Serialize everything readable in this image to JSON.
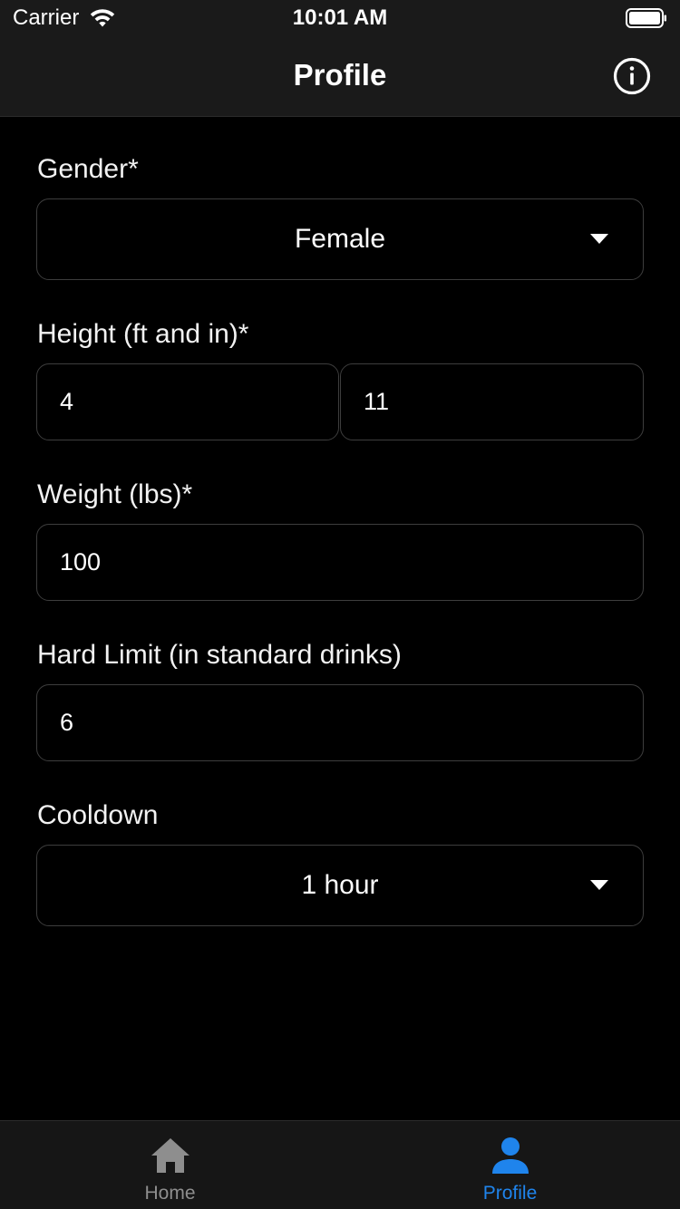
{
  "status_bar": {
    "carrier": "Carrier",
    "time": "10:01 AM",
    "wifi_icon": "wifi-icon",
    "battery_icon": "battery-icon"
  },
  "nav": {
    "title": "Profile",
    "info_icon": "info-icon"
  },
  "form": {
    "gender": {
      "label": "Gender*",
      "value": "Female"
    },
    "height": {
      "label": "Height (ft and in)*",
      "feet": "4",
      "inches": "11"
    },
    "weight": {
      "label": "Weight (lbs)*",
      "value": "100"
    },
    "hard_limit": {
      "label": "Hard Limit (in standard drinks)",
      "value": "6"
    },
    "cooldown": {
      "label": "Cooldown",
      "value": "1 hour"
    }
  },
  "tab_bar": {
    "tabs": [
      {
        "label": "Home",
        "icon": "home-icon",
        "active": false
      },
      {
        "label": "Profile",
        "icon": "person-icon",
        "active": true
      }
    ],
    "active_color": "#1f84ec",
    "inactive_color": "#8e8e8e"
  },
  "colors": {
    "background": "#000000",
    "bar_background": "#1a1a1a",
    "field_border": "#3d3d3d",
    "text": "#ffffff"
  }
}
